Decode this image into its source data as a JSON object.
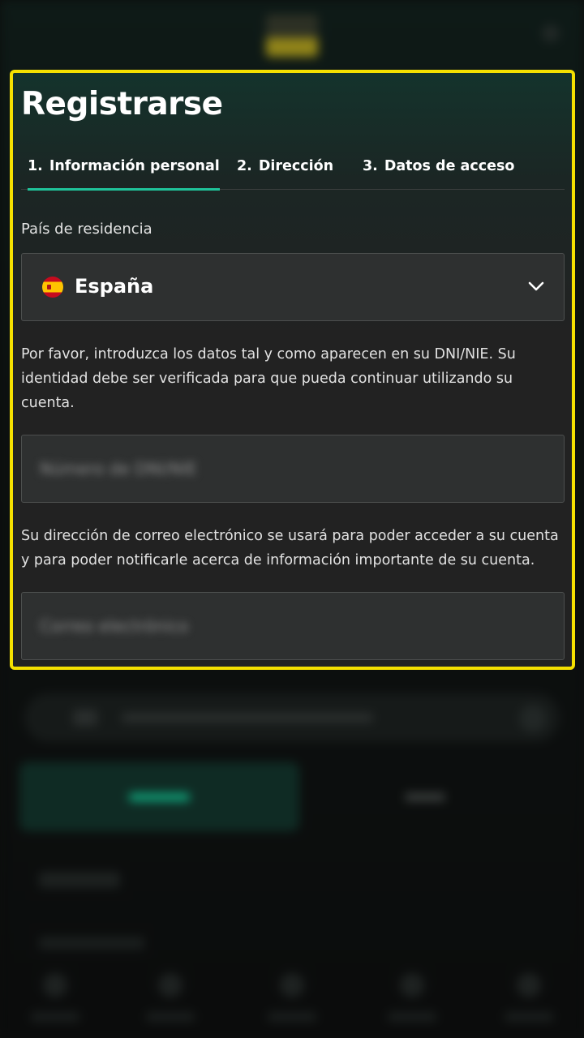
{
  "modal": {
    "title": "Registrarse"
  },
  "steps": [
    {
      "number": "1.",
      "label": "Información personal",
      "active": true
    },
    {
      "number": "2.",
      "label": "Dirección",
      "active": false
    },
    {
      "number": "3.",
      "label": "Datos de acceso",
      "active": false
    }
  ],
  "country": {
    "label": "País de residencia",
    "selected": "España",
    "flag_icon": "spain-flag-icon",
    "chevron_icon": "chevron-down-icon"
  },
  "id_section": {
    "instructions": "Por favor, introduzca los datos tal y como aparecen en su DNI/NIE. Su identidad debe ser verificada para que pueda continuar utilizando su cuenta.",
    "placeholder": "Número de DNI/NIE"
  },
  "email_section": {
    "instructions": "Su dirección de correo electrónico se usará para poder acceder a su cuenta y para poder notificarle acerca de información importante de su cuenta.",
    "placeholder": "Correo electrónico"
  },
  "colors": {
    "highlight_border": "#f5e000",
    "active_tab": "#1fc39a",
    "modal_background": "#222222"
  }
}
